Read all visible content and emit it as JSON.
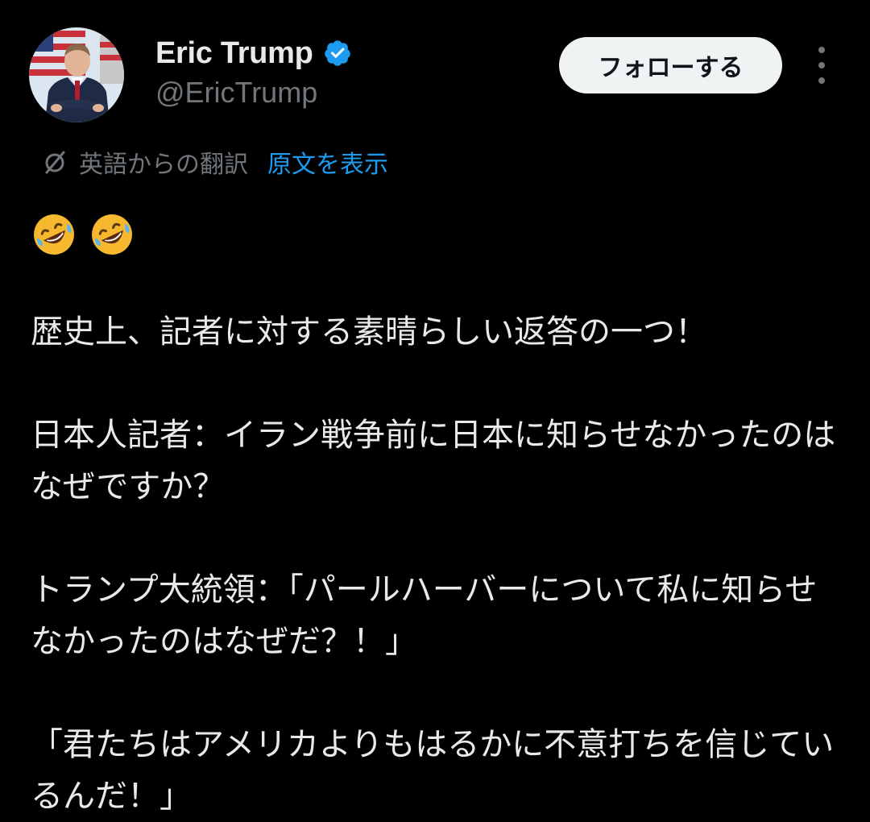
{
  "profile": {
    "display_name": "Eric Trump",
    "handle": "@EricTrump",
    "verified": true
  },
  "header": {
    "follow_label": "フォローする"
  },
  "translation": {
    "label": "英語からの翻訳",
    "show_original": "原文を表示"
  },
  "tweet": {
    "emojis": [
      "rolling-on-floor-laughing-emoji",
      "rolling-on-floor-laughing-emoji"
    ],
    "paragraphs": [
      "歴史上、記者に対する素晴らしい返答の一つ！",
      "日本人記者：イラン戦争前に日本に知らせなかったのはなぜですか？",
      "トランプ大統領：「パールハーバーについて私に知らせなかったのはなぜだ？！」",
      "「君たちはアメリカよりもはるかに不意打ちを信じているんだ！」"
    ]
  },
  "colors": {
    "background": "#000000",
    "text_primary": "#e7e9ea",
    "text_secondary": "#71767b",
    "accent_link": "#1d9bf0",
    "verified_badge": "#1d9bf0",
    "follow_button_bg": "#eff3f4"
  }
}
